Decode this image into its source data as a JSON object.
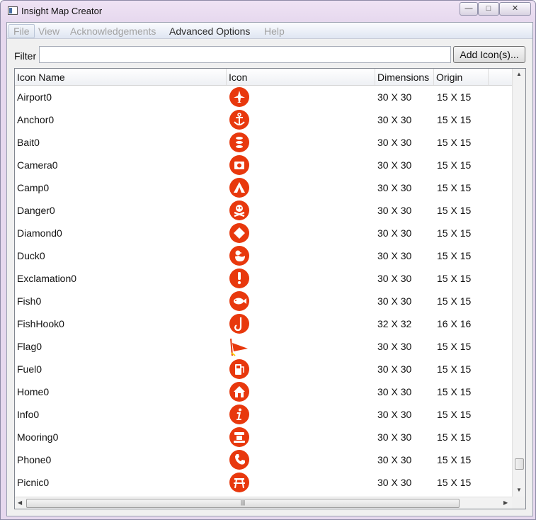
{
  "window": {
    "title": "Insight Map Creator"
  },
  "menu": [
    "File",
    "View",
    "Acknowledgements",
    "Advanced Options",
    "Help"
  ],
  "filter": {
    "label": "Filter",
    "value": ""
  },
  "add_button": "Add Icon(s)...",
  "columns": [
    "Icon Name",
    "Icon",
    "Dimensions",
    "Origin"
  ],
  "icon_color": "#e8380d",
  "rows": [
    {
      "name": "Airport0",
      "icon": "airplane-icon",
      "dimensions": "30 X 30",
      "origin": "15 X 15"
    },
    {
      "name": "Anchor0",
      "icon": "anchor-icon",
      "dimensions": "30 X 30",
      "origin": "15 X 15"
    },
    {
      "name": "Bait0",
      "icon": "bait-fish-icon",
      "dimensions": "30 X 30",
      "origin": "15 X 15"
    },
    {
      "name": "Camera0",
      "icon": "camera-icon",
      "dimensions": "30 X 30",
      "origin": "15 X 15"
    },
    {
      "name": "Camp0",
      "icon": "tent-icon",
      "dimensions": "30 X 30",
      "origin": "15 X 15"
    },
    {
      "name": "Danger0",
      "icon": "skull-crossbones-icon",
      "dimensions": "30 X 30",
      "origin": "15 X 15"
    },
    {
      "name": "Diamond0",
      "icon": "diamond-icon",
      "dimensions": "30 X 30",
      "origin": "15 X 15"
    },
    {
      "name": "Duck0",
      "icon": "duck-icon",
      "dimensions": "30 X 30",
      "origin": "15 X 15"
    },
    {
      "name": "Exclamation0",
      "icon": "exclamation-icon",
      "dimensions": "30 X 30",
      "origin": "15 X 15"
    },
    {
      "name": "Fish0",
      "icon": "fish-icon",
      "dimensions": "30 X 30",
      "origin": "15 X 15"
    },
    {
      "name": "FishHook0",
      "icon": "fish-hook-icon",
      "dimensions": "32 X 32",
      "origin": "16 X 16"
    },
    {
      "name": "Flag0",
      "icon": "flag-icon",
      "dimensions": "30 X 30",
      "origin": "15 X 15"
    },
    {
      "name": "Fuel0",
      "icon": "fuel-pump-icon",
      "dimensions": "30 X 30",
      "origin": "15 X 15"
    },
    {
      "name": "Home0",
      "icon": "home-icon",
      "dimensions": "30 X 30",
      "origin": "15 X 15"
    },
    {
      "name": "Info0",
      "icon": "info-icon",
      "dimensions": "30 X 30",
      "origin": "15 X 15"
    },
    {
      "name": "Mooring0",
      "icon": "mooring-icon",
      "dimensions": "30 X 30",
      "origin": "15 X 15"
    },
    {
      "name": "Phone0",
      "icon": "phone-icon",
      "dimensions": "30 X 30",
      "origin": "15 X 15"
    },
    {
      "name": "Picnic0",
      "icon": "picnic-table-icon",
      "dimensions": "30 X 30",
      "origin": "15 X 15"
    }
  ]
}
